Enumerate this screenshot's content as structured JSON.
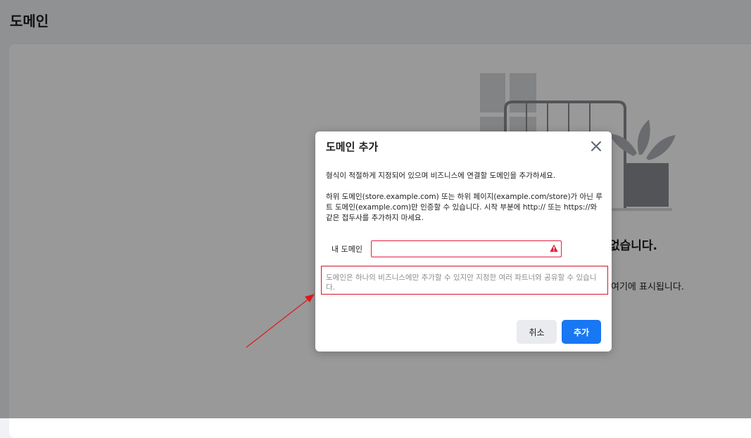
{
  "page": {
    "title": "도메인"
  },
  "background_empty_state": {
    "title": "없습니다.",
    "desc": "여기에 표시됩니다."
  },
  "dialog": {
    "title": "도메인 추가",
    "intro": "형식이 적절하게 지정되어 있으며 비즈니스에 연결할 도메인을 추가하세요.",
    "guidance": "하위 도메인(store.example.com) 또는 하위 페이지(example.com/store)가 아닌 루트 도메인(example.com)만 인증할 수 있습니다. 시작 부분에 http:// 또는 https://와 같은 접두사를 추가하지 마세요.",
    "field_label": "내 도메인",
    "field_value": "",
    "field_placeholder": "",
    "note": "도메인은 하나의 비즈니스에만 추가할 수 있지만 지정한 여러 파트너와 공유할 수 있습니다.",
    "cancel_label": "취소",
    "add_label": "추가"
  },
  "colors": {
    "accent": "#1877f2",
    "error": "#e41e3f",
    "annotation": "#e0161a"
  },
  "icons": {
    "close": "close-icon",
    "warning": "warning-icon"
  }
}
